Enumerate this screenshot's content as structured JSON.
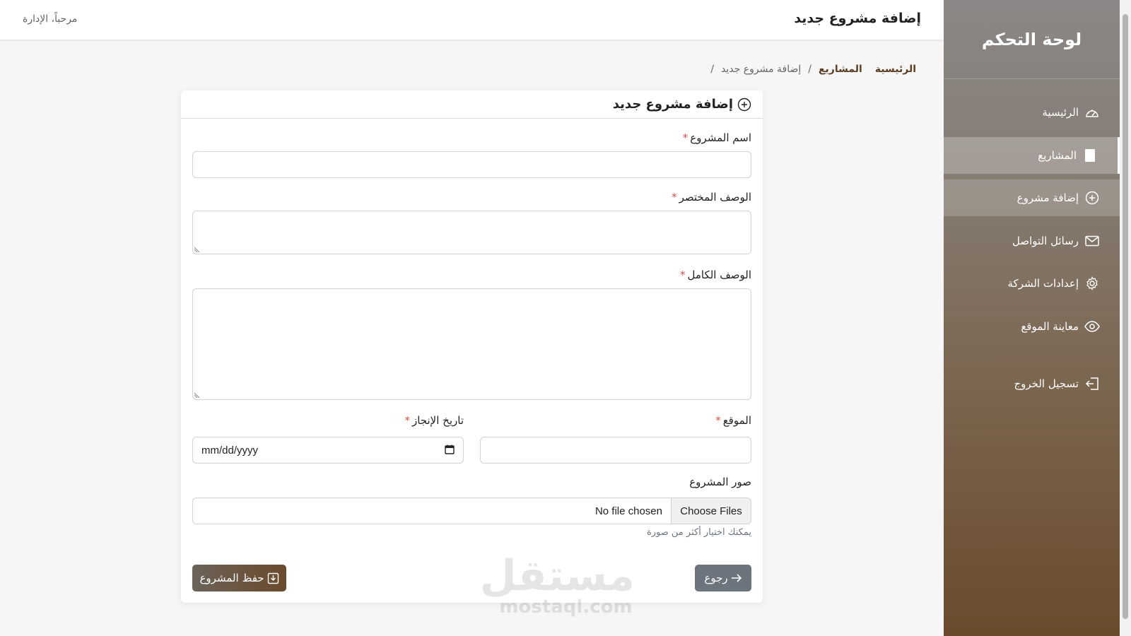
{
  "topbar": {
    "title": "إضافة مشروع جديد",
    "welcome": "مرحباً، الإدارة"
  },
  "sidebar": {
    "title": "لوحة التحكم",
    "items": [
      {
        "label": "الرئيسية",
        "icon": "speedometer-icon",
        "state": "normal"
      },
      {
        "label": "المشاريع",
        "icon": "document-icon",
        "state": "active"
      },
      {
        "label": "إضافة مشروع",
        "icon": "plus-circle-icon",
        "state": "hover"
      },
      {
        "label": "رسائل التواصل",
        "icon": "envelope-icon",
        "state": "normal"
      },
      {
        "label": "إعدادات الشركة",
        "icon": "gear-icon",
        "state": "normal"
      },
      {
        "label": "معاينة الموقع",
        "icon": "eye-icon",
        "state": "normal"
      },
      {
        "label": "تسجيل الخروج",
        "icon": "logout-icon",
        "state": "normal"
      }
    ]
  },
  "breadcrumb": {
    "home": "الرئيسية",
    "projects": "المشاريع",
    "current": "إضافة مشروع جديد",
    "separator": "/"
  },
  "card": {
    "title": "إضافة مشروع جديد",
    "fields": {
      "name": {
        "label": "اسم المشروع",
        "required": "*",
        "value": ""
      },
      "short_desc": {
        "label": "الوصف المختصر",
        "required": "*",
        "value": ""
      },
      "full_desc": {
        "label": "الوصف الكامل",
        "required": "*",
        "value": ""
      },
      "location": {
        "label": "الموقع",
        "required": "*",
        "value": ""
      },
      "date": {
        "label": "تاريخ الإنجاز",
        "required": "*",
        "placeholder": "mm/dd/yyyy"
      },
      "images": {
        "label": "صور المشروع",
        "button": "Choose Files",
        "status": "No file chosen",
        "hint": "يمكنك اختيار أكثر من صورة"
      }
    },
    "buttons": {
      "save": "حفظ المشروع",
      "back": "رجوع"
    }
  },
  "watermark": {
    "arabic": "مستقل",
    "latin": "mostaql.com"
  },
  "colors": {
    "brand_brown": "#6b4a2c",
    "required_red": "#d9534f",
    "back_gray": "#6c757d"
  }
}
